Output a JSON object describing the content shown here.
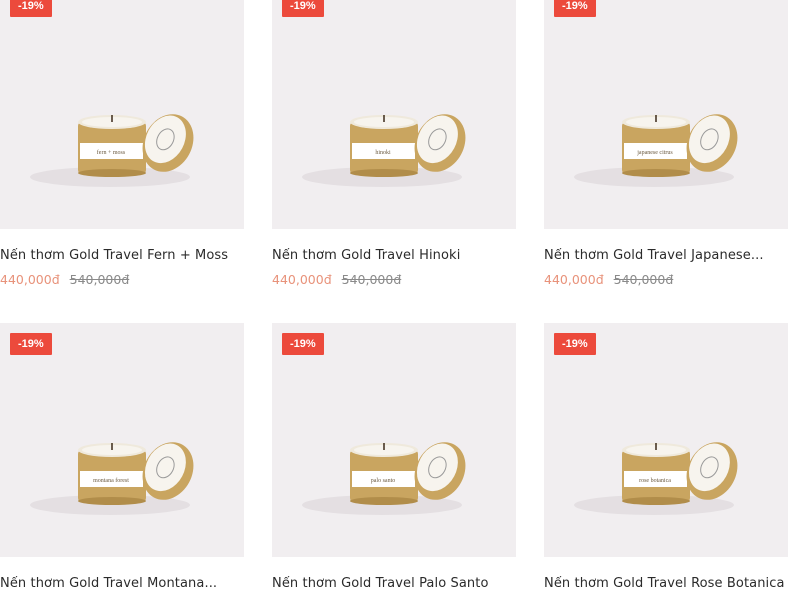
{
  "products": [
    {
      "badge": "-19%",
      "title": "Nến thơm Gold Travel Fern + Moss",
      "price": "440,000đ",
      "old_price": "540,000đ",
      "tin_label": "fern + moss"
    },
    {
      "badge": "-19%",
      "title": "Nến thơm Gold Travel Hinoki",
      "price": "440,000đ",
      "old_price": "540,000đ",
      "tin_label": "hinoki"
    },
    {
      "badge": "-19%",
      "title": "Nến thơm Gold Travel Japanese...",
      "price": "440,000đ",
      "old_price": "540,000đ",
      "tin_label": "japanese citrus"
    },
    {
      "badge": "-19%",
      "title": "Nến thơm Gold Travel Montana...",
      "price": "",
      "old_price": "",
      "tin_label": "montana forest"
    },
    {
      "badge": "-19%",
      "title": "Nến thơm Gold Travel Palo Santo",
      "price": "",
      "old_price": "",
      "tin_label": "palo santo"
    },
    {
      "badge": "-19%",
      "title": "Nến thơm Gold Travel Rose Botanica",
      "price": "",
      "old_price": "",
      "tin_label": "rose botanica"
    }
  ],
  "colors": {
    "badge": "#ec4a3c",
    "sale_price": "#e8927a",
    "image_bg": "#f1eef0",
    "tin_gold": "#c9a560"
  }
}
